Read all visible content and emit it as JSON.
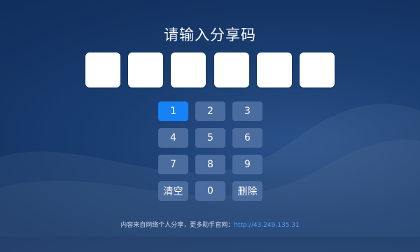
{
  "title": "请输入分享码",
  "code_boxes": [
    "",
    "",
    "",
    "",
    "",
    ""
  ],
  "keypad": {
    "keys": [
      "1",
      "2",
      "3",
      "4",
      "5",
      "6",
      "7",
      "8",
      "9",
      "清空",
      "0",
      "删除"
    ],
    "active_index": 0
  },
  "footer": {
    "text": "内容来自网络个人分享，更多助手官网：",
    "link": "http://43.249.135.31"
  },
  "colors": {
    "background": "#143465",
    "key": "#4a6c9e",
    "key_active": "#1781f6",
    "link": "#49a3ff"
  }
}
